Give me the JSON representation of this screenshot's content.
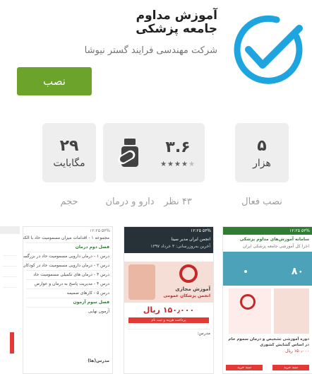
{
  "app": {
    "title": "آموزش مداوم جامعه پزشکی",
    "developer": "شرکت مهندسی فرایند گستر نیوشا",
    "install_label": "نصب",
    "accent_color": "#6ca42b",
    "icon": "check-circle-icon"
  },
  "stats": [
    {
      "value": "۵",
      "unit": "هزار",
      "label": "نصب فعال"
    },
    {
      "value": "۳.۶",
      "rating": 3.6,
      "label": "۴۳ نظر"
    },
    {
      "icon": "pill-icon",
      "label": "دارو و درمان"
    },
    {
      "value": "۲۹",
      "unit": "مگابایت",
      "label": "حجم"
    }
  ],
  "screenshots": {
    "shot1": {
      "status": "۱۲:۲۵ ۵۳%",
      "title": "سامانه آموزش‌های مداوم پزشکی",
      "subtitle": "اجرا کل آموزشی جامعه پزشکی ایران",
      "stat_value": "۸۰",
      "course": "دوره آموزشی تشخیص و درمان سموم خام در اساس گشایش کشوری",
      "price": "۱۵۰٫۰۰۰ ریال",
      "cart": "سبد خرید"
    },
    "shot2": {
      "status": "۱۲:۲۵ ۵۳%",
      "header": "انجمن ایران مدیر سینا",
      "date": "آخرین به‌روزرسانی: ۳ خرداد ۱۳۹۷",
      "course_title": "آموزش مجازی",
      "org": "انجمن پزشکان عمومی",
      "price": "۱۵۰٫۰۰۰ ریال",
      "register": "پرداخت هزینه و ثبت نام",
      "teacher": "مدرس:"
    },
    "shot3": {
      "status": "۱۲:۲۵ ۵۳%",
      "items": [
        "مجموعه ۱ - اقدامات میزان مسمومیت حاد با الکترولیت",
        "فصل دوم درمان",
        "درس ۱ - درمان دارویی مسمومیت حاد در بزرگسالان",
        "درس ۲ - درمان دارویی مسمومیت حاد در کودکان",
        "درس ۳ - درمان های تکمیلی مسمومیت حاد",
        "درس ۴ - مدیریت پاسخ به درمان و عوارض",
        "درس ۵ - کارهای ضمیمه",
        "فصل سوم آزمون",
        "آزمون نهایی"
      ],
      "teacher": "مدرس(ها)"
    }
  }
}
